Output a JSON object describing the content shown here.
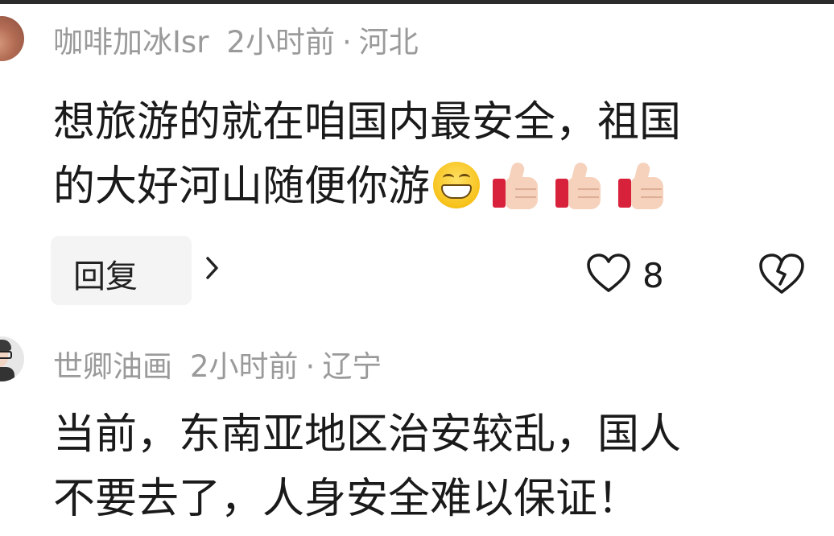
{
  "comments": [
    {
      "username": "咖啡加冰Isr",
      "time": "2小时前",
      "separator": "·",
      "location": "河北",
      "lines": [
        "想旅游的就在咱国内最安全，祖国",
        "的大好河山随便你游"
      ],
      "emojis": [
        "grinning-face-icon",
        "thumbs-up-icon",
        "thumbs-up-icon",
        "thumbs-up-icon"
      ],
      "reply_label": "回复",
      "reply_chevron": "›",
      "like_count": "8"
    },
    {
      "username": "世卿油画",
      "time": "2小时前",
      "separator": "·",
      "location": "辽宁",
      "lines": [
        "当前，东南亚地区治安较乱，国人",
        "不要去了，人身安全难以保证！"
      ]
    }
  ],
  "icons": {
    "like": "heart-outline-icon",
    "dislike": "broken-heart-icon",
    "reply_arrow": "chevron-right-icon"
  },
  "colors": {
    "meta_text": "#9a9a9a",
    "body_text": "#1a1a1a",
    "reply_bg": "#f4f4f4",
    "thumb_cuff": "#d8223b"
  }
}
